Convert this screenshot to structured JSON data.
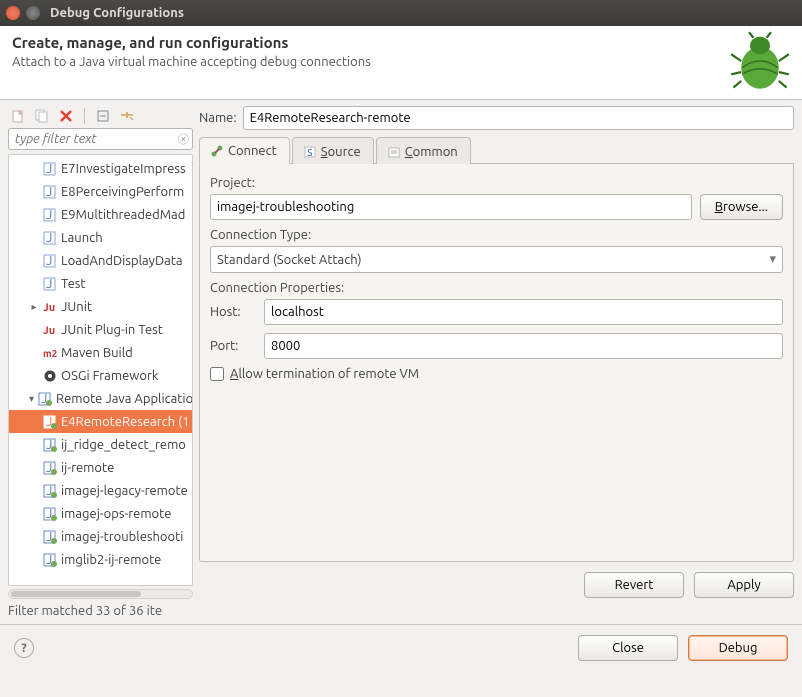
{
  "window": {
    "title": "Debug Configurations"
  },
  "header": {
    "title": "Create, manage, and run configurations",
    "subtitle": "Attach to a Java virtual machine accepting debug connections"
  },
  "filter": {
    "placeholder": "type filter text"
  },
  "tree": {
    "items": [
      {
        "label": "E7InvestigateImpress",
        "indent": 2,
        "icon": "java-file"
      },
      {
        "label": "E8PerceivingPerform",
        "indent": 2,
        "icon": "java-file"
      },
      {
        "label": "E9MultithreadedMad",
        "indent": 2,
        "icon": "java-file"
      },
      {
        "label": "Launch",
        "indent": 2,
        "icon": "java-file"
      },
      {
        "label": "LoadAndDisplayData",
        "indent": 2,
        "icon": "java-file"
      },
      {
        "label": "Test",
        "indent": 2,
        "icon": "java-file"
      },
      {
        "label": "JUnit",
        "indent": 1,
        "icon": "junit",
        "expander": "▸"
      },
      {
        "label": "JUnit Plug-in Test",
        "indent": 1,
        "icon": "junit-plug"
      },
      {
        "label": "Maven Build",
        "indent": 1,
        "icon": "maven"
      },
      {
        "label": "OSGi Framework",
        "indent": 1,
        "icon": "osgi"
      },
      {
        "label": "Remote Java Application",
        "indent": 1,
        "icon": "remote-cat",
        "expander": "▾"
      },
      {
        "label": "E4RemoteResearch (1",
        "indent": 2,
        "icon": "remote",
        "selected": true
      },
      {
        "label": "ij_ridge_detect_remo",
        "indent": 2,
        "icon": "remote"
      },
      {
        "label": "ij-remote",
        "indent": 2,
        "icon": "remote"
      },
      {
        "label": "imagej-legacy-remote",
        "indent": 2,
        "icon": "remote"
      },
      {
        "label": "imagej-ops-remote",
        "indent": 2,
        "icon": "remote"
      },
      {
        "label": "imagej-troubleshooti",
        "indent": 2,
        "icon": "remote"
      },
      {
        "label": "imglib2-ij-remote",
        "indent": 2,
        "icon": "remote"
      }
    ],
    "filterStatus": "Filter matched 33 of 36 ite"
  },
  "nameField": {
    "label": "Name:",
    "value": "E4RemoteResearch-remote"
  },
  "tabs": {
    "connect": "Connect",
    "source": "Source",
    "common": "Common"
  },
  "form": {
    "projectLabel": "Project:",
    "projectValue": "imagej-troubleshooting",
    "browse": "Browse...",
    "connTypeLabel": "Connection Type:",
    "connTypeValue": "Standard (Socket Attach)",
    "connPropsLabel": "Connection Properties:",
    "hostLabel": "Host:",
    "hostValue": "localhost",
    "portLabel": "Port:",
    "portValue": "8000",
    "allowTerm": "Allow termination of remote VM",
    "revert": "Revert",
    "apply": "Apply"
  },
  "footer": {
    "close": "Close",
    "debug": "Debug"
  }
}
